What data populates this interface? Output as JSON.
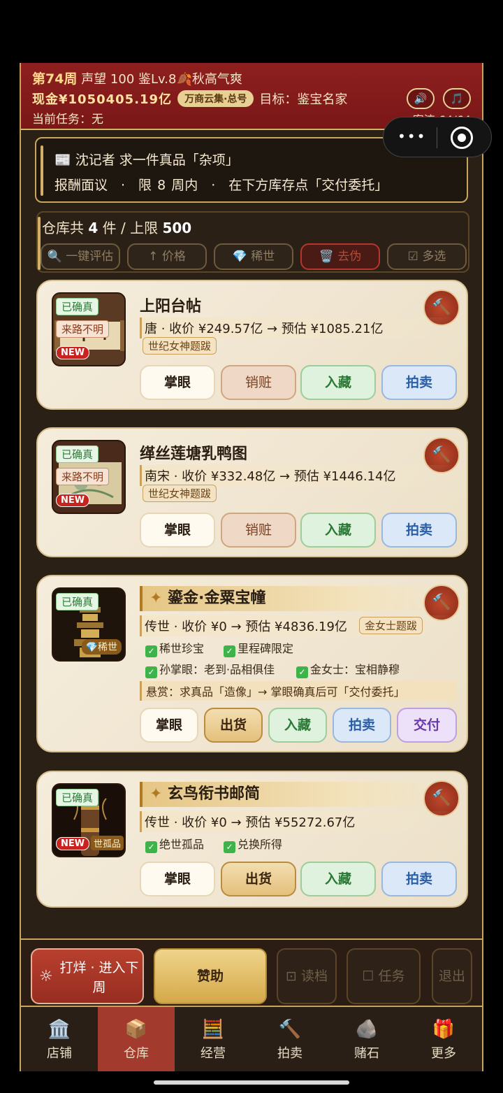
{
  "header": {
    "week": "第74周",
    "reputation": "声望 100",
    "level": "鉴Lv.8",
    "season": "🍂秋高气爽",
    "cash": "现金¥1050405.19亿",
    "guild_badge": "万商云集·总号",
    "goal": "目标：鉴宝名家",
    "current_task": "当前任务：无",
    "sound_icon": "🔊",
    "music_icon": "🎵",
    "customers": "客流 64/64"
  },
  "task_card": {
    "line1": "📰 沈记者 求一件真品「杂项」",
    "line2": "报酬面议　·　限 8 周内　·　在下方库存点「交付委托」"
  },
  "stock": {
    "title_prefix": "仓库共",
    "count": "4",
    "title_mid": "件 / 上限",
    "limit": "500",
    "tools": [
      {
        "label": "🔍 一键评估"
      },
      {
        "label": "↑ 价格"
      },
      {
        "label": "💎 稀世"
      },
      {
        "label": "🗑️ 去伪"
      },
      {
        "label": "☑ 多选"
      }
    ]
  },
  "items": [
    {
      "verified": "已确真",
      "origin": "来路不明",
      "new_badge": "NEW",
      "name": "上阳台帖",
      "price": "唐 · 收价 ¥249.57亿 → 预估 ¥1085.21亿",
      "inscription": "世纪女神题跋",
      "buttons": [
        "掌眼",
        "销赃",
        "入藏",
        "拍卖"
      ]
    },
    {
      "verified": "已确真",
      "origin": "来路不明",
      "new_badge": "NEW",
      "name": "缂丝莲塘乳鸭图",
      "price": "南宋 · 收价 ¥332.48亿 → 预估 ¥1446.14亿",
      "inscription": "世纪女神题跋",
      "buttons": [
        "掌眼",
        "销赃",
        "入藏",
        "拍卖"
      ]
    },
    {
      "verified": "已确真",
      "rare_badge": "💎稀世",
      "name": "鎏金·金粟宝幢",
      "price": "传世 · 收价 ¥0 → 预估 ¥4836.19亿",
      "inscription": "金女士题跋",
      "checks": [
        "稀世珍宝",
        "里程碑限定",
        "孙掌眼：老到·品相俱佳",
        "金女士：宝相静穆"
      ],
      "bounty": "悬赏：求真品「造像」→ 掌眼确真后可「交付委托」",
      "buttons": [
        "掌眼",
        "出货",
        "入藏",
        "拍卖",
        "交付"
      ]
    },
    {
      "verified": "已确真",
      "new_badge": "NEW",
      "solo_badge": "世孤品",
      "name": "玄鸟衔书邮简",
      "price": "传世 · 收价 ¥0 → 预估 ¥55272.67亿",
      "checks": [
        "绝世孤品",
        "兑换所得"
      ],
      "buttons": [
        "掌眼",
        "出货",
        "入藏",
        "拍卖"
      ]
    }
  ],
  "bottom_actions": {
    "next_week": "打烊 · 进入下周",
    "sponsor": "赞助",
    "load": "⊡ 读档",
    "tasks": "☐ 任务",
    "exit": "退出"
  },
  "nav": [
    {
      "label": "店铺",
      "icon": "🏛️"
    },
    {
      "label": "仓库",
      "icon": "📦"
    },
    {
      "label": "经营",
      "icon": "🧮"
    },
    {
      "label": "拍卖",
      "icon": "🔨"
    },
    {
      "label": "赌石",
      "icon": "🪨"
    },
    {
      "label": "更多",
      "icon": "🎁"
    }
  ],
  "check_mark": "✓",
  "hammer_icon": "🔨"
}
